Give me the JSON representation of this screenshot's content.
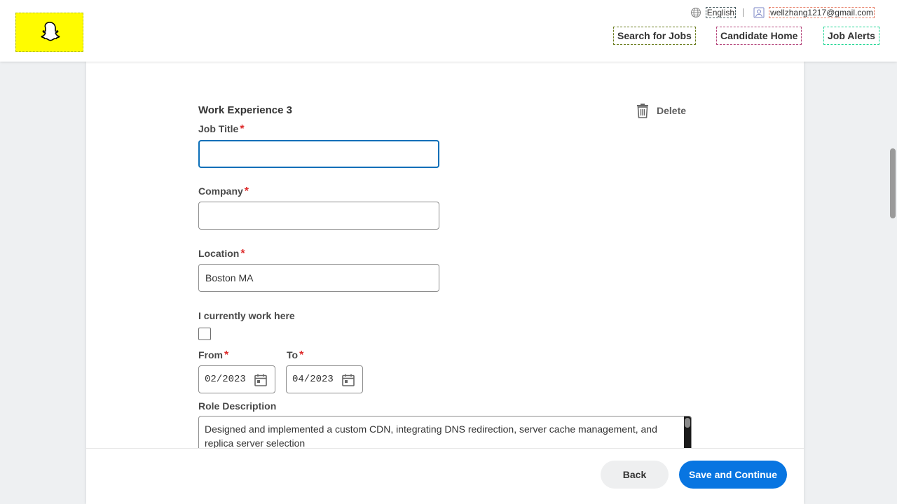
{
  "header": {
    "logo_name": "snapchat-ghost-logo",
    "language": "English",
    "user_email": "wellzhang1217@gmail.com",
    "nav": {
      "search": "Search for Jobs",
      "home": "Candidate Home",
      "alerts": "Job Alerts"
    }
  },
  "form": {
    "section_title": "Work Experience 3",
    "delete_label": "Delete",
    "job_title": {
      "label": "Job Title",
      "required": "*",
      "value": ""
    },
    "company": {
      "label": "Company",
      "required": "*",
      "value": ""
    },
    "location": {
      "label": "Location",
      "required": "*",
      "value": "Boston MA"
    },
    "current": {
      "label": "I currently work here",
      "checked": false
    },
    "from": {
      "label": "From",
      "required": "*",
      "value": "02/2023"
    },
    "to": {
      "label": "To",
      "required": "*",
      "value": "04/2023"
    },
    "role_description": {
      "label": "Role Description",
      "value": "Designed and implemented a custom CDN, integrating DNS redirection, server cache management, and replica server selection"
    }
  },
  "footer": {
    "back_label": "Back",
    "save_label": "Save and Continue"
  },
  "colors": {
    "brand_yellow": "#fffc00",
    "primary_blue": "#0875e1",
    "required_red": "#de2d2d"
  }
}
